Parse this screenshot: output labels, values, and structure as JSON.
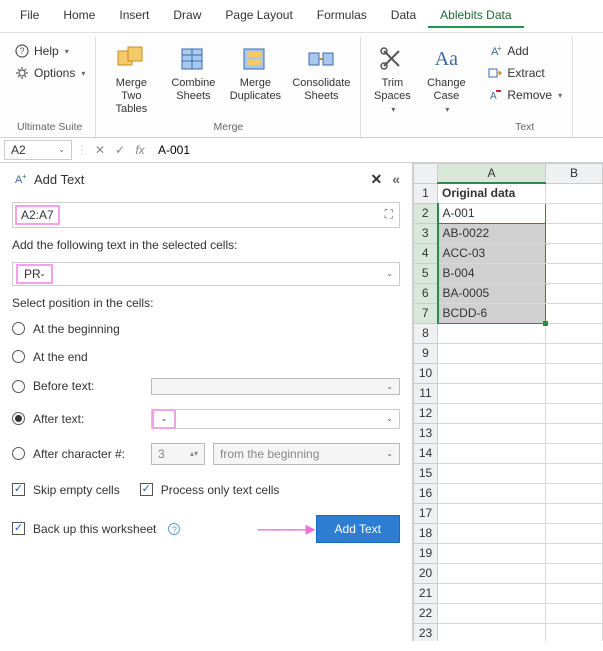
{
  "menu": [
    "File",
    "Home",
    "Insert",
    "Draw",
    "Page Layout",
    "Formulas",
    "Data",
    "Ablebits Data"
  ],
  "active_menu": 7,
  "ribbon": {
    "ultimate": {
      "help": "Help",
      "options": "Options",
      "group": "Ultimate Suite"
    },
    "merge": {
      "tables": "Merge\nTwo Tables",
      "combine": "Combine\nSheets",
      "dup": "Merge\nDuplicates",
      "consol": "Consolidate\nSheets",
      "group": "Merge"
    },
    "text": {
      "trim": "Trim\nSpaces",
      "case": "Change\nCase",
      "add": "Add",
      "extract": "Extract",
      "remove": "Remove",
      "group": "Text"
    }
  },
  "formula_bar": {
    "name_box": "A2",
    "value": "A-001"
  },
  "pane": {
    "title": "Add Text",
    "range": "A2:A7",
    "label_add": "Add the following text in the selected cells:",
    "text_to_add": "PR-",
    "label_pos": "Select position in the cells:",
    "opt_begin": "At the beginning",
    "opt_end": "At the end",
    "opt_before": "Before text:",
    "opt_after": "After text:",
    "after_value": "-",
    "opt_charnum": "After character #:",
    "char_num": "3",
    "char_from": "from the beginning",
    "chk_skip": "Skip empty cells",
    "chk_textonly": "Process only text cells",
    "chk_backup": "Back up this worksheet",
    "btn": "Add Text"
  },
  "grid": {
    "cols": [
      "A",
      "B"
    ],
    "header": "Original data",
    "rows": [
      "A-001",
      "AB-0022",
      "ACC-03",
      "B-004",
      "BA-0005",
      "BCDD-6"
    ]
  }
}
